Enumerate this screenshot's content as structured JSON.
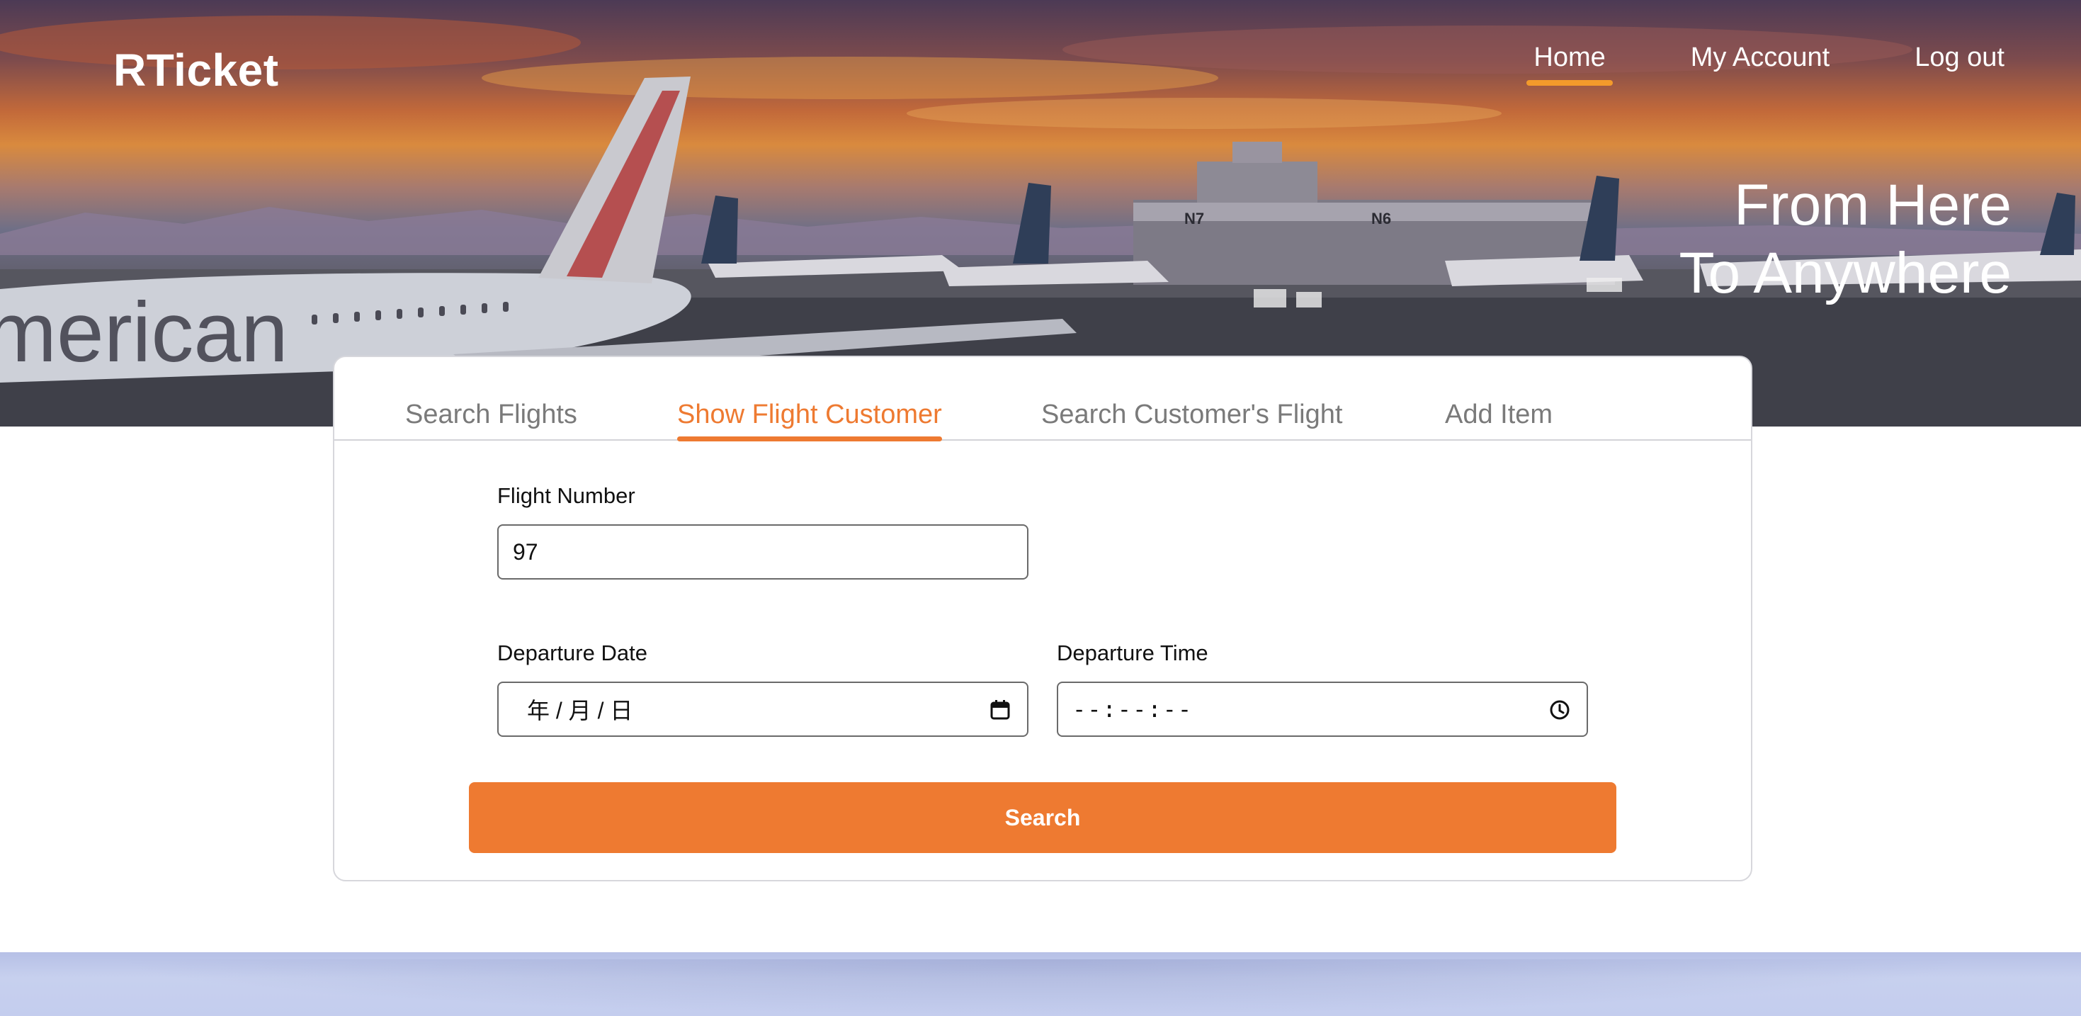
{
  "brand": {
    "name": "RTicket"
  },
  "nav": {
    "items": [
      {
        "label": "Home",
        "active": true
      },
      {
        "label": "My Account",
        "active": false
      },
      {
        "label": "Log out",
        "active": false
      }
    ]
  },
  "hero": {
    "tagline_line1": "From Here",
    "tagline_line2": "To Anywhere"
  },
  "tabs": [
    {
      "label": "Search Flights",
      "active": false
    },
    {
      "label": "Show Flight Customer",
      "active": true
    },
    {
      "label": "Search Customer's Flight",
      "active": false
    },
    {
      "label": "Add Item",
      "active": false
    }
  ],
  "form": {
    "flight_number": {
      "label": "Flight Number",
      "value": "97"
    },
    "departure_date": {
      "label": "Departure Date",
      "placeholder": "年 / 月 / 日",
      "icon": "calendar-icon"
    },
    "departure_time": {
      "label": "Departure Time",
      "placeholder": "--:--:--",
      "icon": "clock-icon"
    },
    "submit_label": "Search"
  },
  "colors": {
    "accent": "#ee7a31",
    "nav_underline": "#f39a2b",
    "footer_band": "#c4cdee"
  }
}
